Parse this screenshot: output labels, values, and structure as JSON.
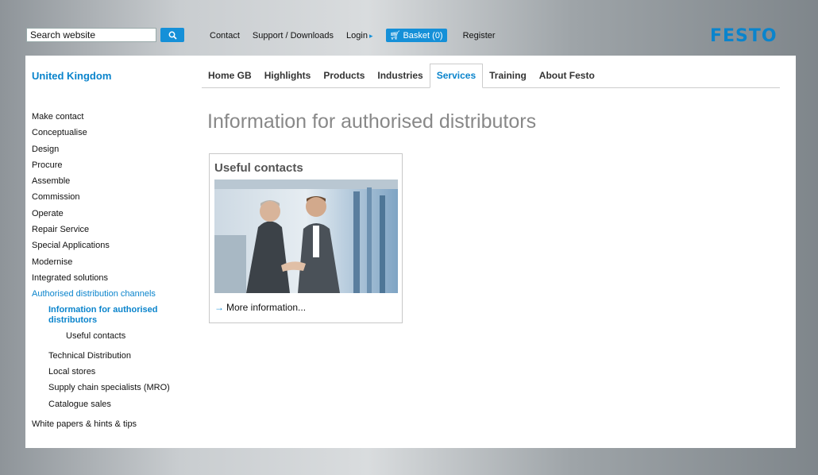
{
  "search": {
    "value": "Search website",
    "button_icon": "magnifier-icon"
  },
  "top_nav": {
    "contact": "Contact",
    "support": "Support / Downloads",
    "login": "Login",
    "basket": "Basket (0)",
    "register": "Register"
  },
  "logo": {
    "text": "FESTO",
    "color": "#0a84cc"
  },
  "region": "United Kingdom",
  "main_nav": {
    "tabs": [
      "Home GB",
      "Highlights",
      "Products",
      "Industries",
      "Services",
      "Training",
      "About Festo"
    ],
    "active": "Services"
  },
  "sidebar": {
    "items": [
      "Make contact",
      "Conceptualise",
      "Design",
      "Procure",
      "Assemble",
      "Commission",
      "Operate",
      "Repair Service",
      "Special Applications",
      "Modernise",
      "Integrated solutions"
    ],
    "active_section": "Authorised distribution channels",
    "active_page": "Information for authorised distributors",
    "active_child": "Useful contacts",
    "siblings": [
      "Technical Distribution",
      "Local stores",
      "Supply chain specialists (MRO)",
      "Catalogue sales"
    ],
    "last_item": "White papers & hints & tips"
  },
  "page_title": "Information for authorised distributors",
  "card": {
    "title": "Useful contacts",
    "image_subject": "two businessmen shaking hands",
    "link": "More information..."
  },
  "colors": {
    "accent": "#1590d8",
    "brand": "#0a84cc",
    "title_gray": "#888888"
  }
}
